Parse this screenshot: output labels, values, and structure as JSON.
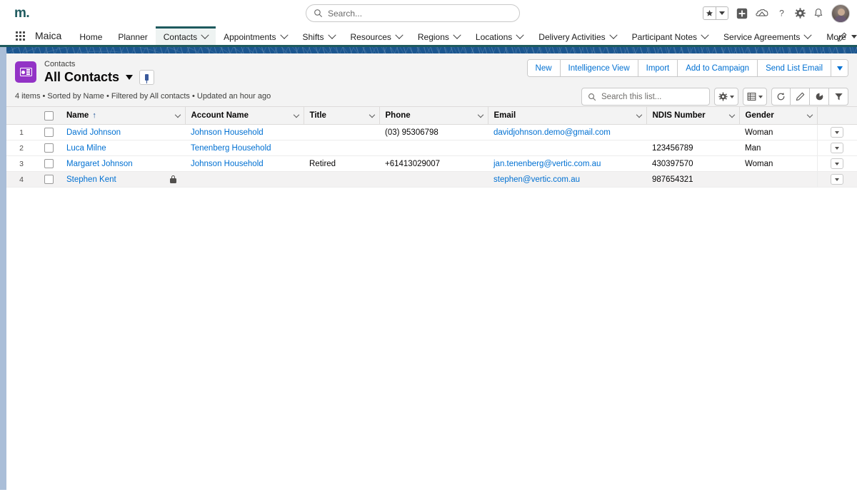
{
  "global_header": {
    "logo_text": "m.",
    "search_placeholder": "Search...",
    "icons": [
      {
        "name": "favorites-star-icon",
        "glyph": "★"
      },
      {
        "name": "favorites-dropdown-icon",
        "glyph": "▾"
      },
      {
        "name": "add-icon",
        "glyph": "+"
      },
      {
        "name": "cloud-home-icon",
        "glyph": "⛰"
      },
      {
        "name": "help-icon",
        "glyph": "?"
      },
      {
        "name": "settings-gear-icon",
        "glyph": "⚙"
      },
      {
        "name": "notifications-bell-icon",
        "glyph": "🔔"
      }
    ]
  },
  "nav": {
    "app_name": "Maica",
    "items": [
      {
        "label": "Home",
        "has_caret": false,
        "active": false
      },
      {
        "label": "Planner",
        "has_caret": false,
        "active": false
      },
      {
        "label": "Contacts",
        "has_caret": true,
        "active": true
      },
      {
        "label": "Appointments",
        "has_caret": true,
        "active": false
      },
      {
        "label": "Shifts",
        "has_caret": true,
        "active": false
      },
      {
        "label": "Resources",
        "has_caret": true,
        "active": false
      },
      {
        "label": "Regions",
        "has_caret": true,
        "active": false
      },
      {
        "label": "Locations",
        "has_caret": true,
        "active": false
      },
      {
        "label": "Delivery Activities",
        "has_caret": true,
        "active": false
      },
      {
        "label": "Participant Notes",
        "has_caret": true,
        "active": false
      },
      {
        "label": "Service Agreements",
        "has_caret": true,
        "active": false
      },
      {
        "label": "More",
        "has_caret": true,
        "active": false
      }
    ],
    "edit_nav_icon": "pencil-icon"
  },
  "list_header": {
    "object_label": "Contacts",
    "view_name": "All Contacts",
    "object_icon": "contact-card-icon",
    "pin_icon": "pin-icon",
    "actions": [
      {
        "label": "New"
      },
      {
        "label": "Intelligence View"
      },
      {
        "label": "Import"
      },
      {
        "label": "Add to Campaign"
      },
      {
        "label": "Send List Email"
      }
    ],
    "actions_more_icon": "chevron-down-icon"
  },
  "list_meta": {
    "summary": "4 items • Sorted by Name • Filtered by All contacts • Updated an hour ago"
  },
  "list_tools": {
    "search_placeholder": "Search this list...",
    "buttons": [
      {
        "name": "list-settings-button",
        "icon": "gear-icon",
        "has_caret": true
      },
      {
        "name": "list-display-button",
        "icon": "table-icon",
        "has_caret": true
      },
      {
        "name": "refresh-button",
        "icon": "refresh-icon",
        "has_caret": false
      },
      {
        "name": "edit-list-button",
        "icon": "pencil-icon",
        "has_caret": false
      },
      {
        "name": "charts-button",
        "icon": "pie-chart-icon",
        "has_caret": false
      },
      {
        "name": "filter-button",
        "icon": "funnel-icon",
        "has_caret": false
      }
    ]
  },
  "table": {
    "columns": [
      {
        "key": "name",
        "label": "Name",
        "sorted": "asc"
      },
      {
        "key": "account",
        "label": "Account Name",
        "sorted": null
      },
      {
        "key": "title",
        "label": "Title",
        "sorted": null
      },
      {
        "key": "phone",
        "label": "Phone",
        "sorted": null
      },
      {
        "key": "email",
        "label": "Email",
        "sorted": null
      },
      {
        "key": "ndis",
        "label": "NDIS Number",
        "sorted": null
      },
      {
        "key": "gender",
        "label": "Gender",
        "sorted": null
      }
    ],
    "sort_asc_glyph": "↑",
    "rows": [
      {
        "num": "1",
        "name": "David Johnson",
        "locked": false,
        "account": "Johnson Household",
        "title": "",
        "phone": "(03) 95306798",
        "email": "davidjohnson.demo@gmail.com",
        "ndis": "",
        "gender": "Woman",
        "hovered": false
      },
      {
        "num": "2",
        "name": "Luca Milne",
        "locked": false,
        "account": "Tenenberg Household",
        "title": "",
        "phone": "",
        "email": "",
        "ndis": "123456789",
        "gender": "Man",
        "hovered": false
      },
      {
        "num": "3",
        "name": "Margaret Johnson",
        "locked": false,
        "account": "Johnson Household",
        "title": "Retired",
        "phone": "+61413029007",
        "email": "jan.tenenberg@vertic.com.au",
        "ndis": "430397570",
        "gender": "Woman",
        "hovered": false
      },
      {
        "num": "4",
        "name": "Stephen Kent",
        "locked": true,
        "account": "",
        "title": "",
        "phone": "",
        "email": "stephen@vertic.com.au",
        "ndis": "987654321",
        "gender": "",
        "hovered": true
      }
    ]
  },
  "colors": {
    "brand_teal": "#1e5a5e",
    "link_blue": "#0070d2",
    "object_purple": "#9333c6",
    "page_blue": "#1b568f"
  }
}
